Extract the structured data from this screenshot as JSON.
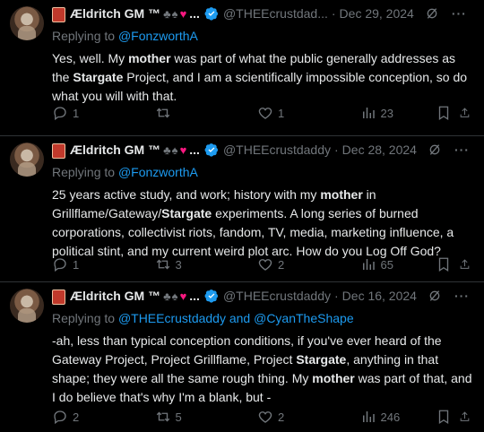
{
  "tweets": [
    {
      "display_name": "Ældritch GM ™",
      "name_suffix": "...",
      "handle": "@THEEcrustdad...",
      "date": "Dec 29, 2024",
      "replying_prefix": "Replying to",
      "replying_to": "@FonzworthA",
      "text_parts": [
        "Yes, well. My ",
        "mother",
        " was part of what the public generally addresses as the ",
        "Stargate",
        " Project, and I am a scientifically impossible conception, so do what you will with that."
      ],
      "counts": {
        "replies": "1",
        "retweets": "",
        "likes": "1",
        "views": "23"
      }
    },
    {
      "display_name": "Ældritch GM ™",
      "name_suffix": "...",
      "handle": "@THEEcrustdaddy",
      "date": "Dec 28, 2024",
      "replying_prefix": "Replying to",
      "replying_to": "@FonzworthA",
      "text_parts": [
        "25 years active study, and work; history with my ",
        "mother",
        " in Grillflame/Gateway/",
        "Stargate",
        " experiments. A long series of burned corporations, collectivist riots, fandom, TV, media, marketing influence, a political stint, and my current weird plot arc. How do you Log Off God?"
      ],
      "counts": {
        "replies": "1",
        "retweets": "3",
        "likes": "2",
        "views": "65"
      }
    },
    {
      "display_name": "Ældritch GM ™",
      "name_suffix": "...",
      "handle": "@THEEcrustdaddy",
      "date": "Dec 16, 2024",
      "replying_prefix": "Replying to",
      "replying_to": "@THEEcrustdaddy and @CyanTheShape",
      "text_parts": [
        "-ah, less than typical conception conditions, if you've ever heard of the Gateway Project, Project Grillflame, Project ",
        "Stargate",
        ", anything in that shape; they were all the same rough thing. My ",
        "mother",
        " was part of that, and I do believe that's why I'm a blank, but -"
      ],
      "counts": {
        "replies": "2",
        "retweets": "5",
        "likes": "2",
        "views": "246"
      }
    }
  ],
  "ui": {
    "dot": "·",
    "more": "···",
    "suits": "♣♠",
    "heart": "♥"
  },
  "colors": {
    "accent": "#1d9bf0",
    "muted": "#71767b",
    "text": "#e7e9ea",
    "background": "#000000"
  }
}
